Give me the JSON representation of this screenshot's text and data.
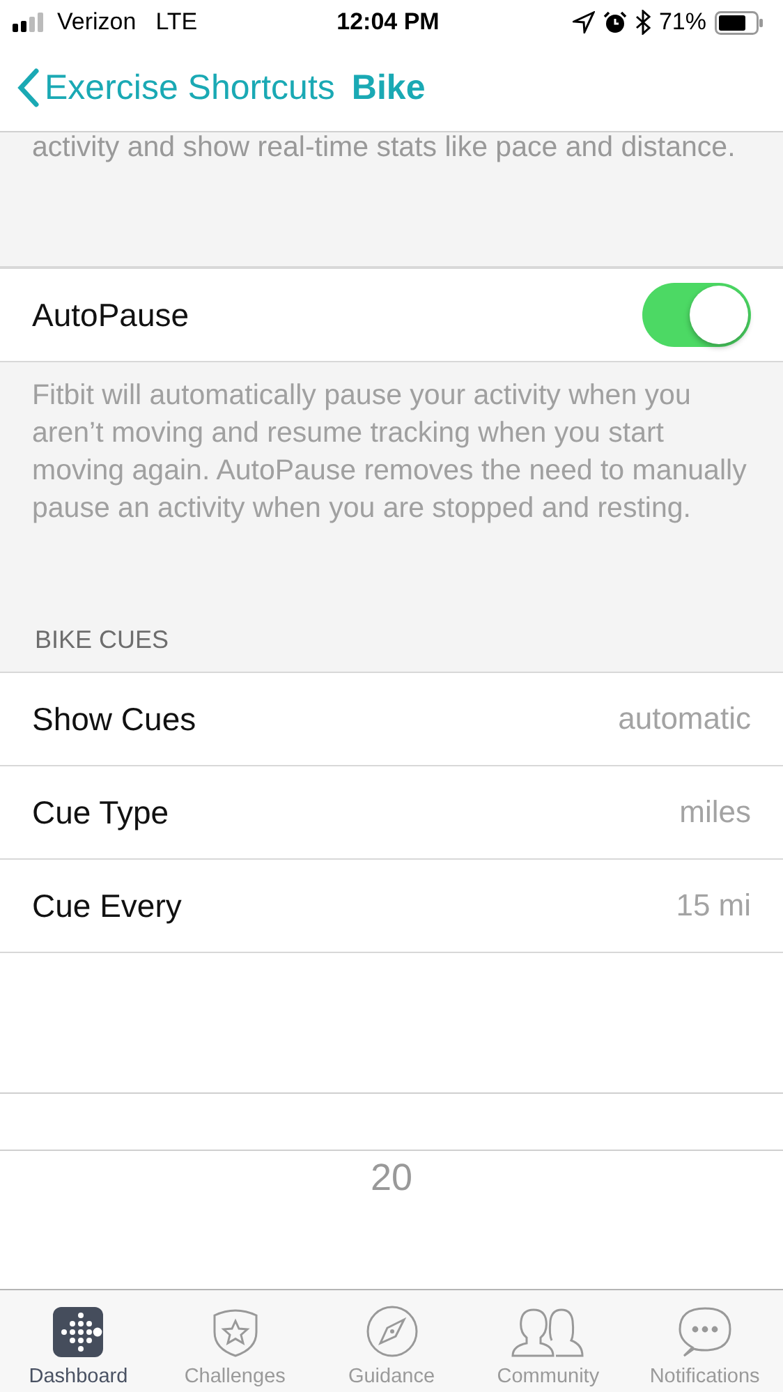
{
  "status_bar": {
    "carrier": "Verizon",
    "network": "LTE",
    "time": "12:04 PM",
    "battery": "71%"
  },
  "nav": {
    "back": "Exercise Shortcuts",
    "title": "Bike"
  },
  "intro_text": "activity and show real-time stats like pace and distance.",
  "autopause": {
    "label": "AutoPause",
    "on": true,
    "description": "Fitbit will automatically pause your activity when you aren’t moving and resume tracking when you start moving again. AutoPause removes the need to manually pause an activity when you are stopped and resting."
  },
  "section_header": "BIKE CUES",
  "rows": [
    {
      "label": "Show Cues",
      "value": "automatic"
    },
    {
      "label": "Cue Type",
      "value": "miles"
    },
    {
      "label": "Cue Every",
      "value": "15 mi"
    }
  ],
  "picker": {
    "options": [
      "20"
    ]
  },
  "tabs": [
    {
      "label": "Dashboard",
      "selected": true,
      "kind": "dashboard"
    },
    {
      "label": "Challenges",
      "selected": false,
      "kind": "challenges"
    },
    {
      "label": "Guidance",
      "selected": false,
      "kind": "guidance"
    },
    {
      "label": "Community",
      "selected": false,
      "kind": "community"
    },
    {
      "label": "Notifications",
      "selected": false,
      "kind": "notifications"
    }
  ]
}
